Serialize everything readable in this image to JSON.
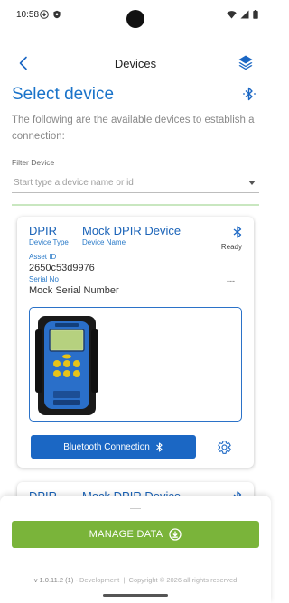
{
  "status_bar": {
    "time": "10:58"
  },
  "header": {
    "title": "Devices"
  },
  "page": {
    "title": "Select device",
    "intro": "The following are the available devices to establish a connection:"
  },
  "filter": {
    "label": "Filter Device",
    "placeholder": "Start type a device name or id"
  },
  "devices": [
    {
      "type": "DPIR",
      "type_caption": "Device Type",
      "name": "Mock DPIR Device",
      "name_caption": "Device Name",
      "status": "Ready",
      "asset_caption": "Asset ID",
      "asset_id": "2650c53d9976",
      "serial_caption": "Serial No",
      "serial": "Mock Serial Number",
      "extra": "---",
      "connect_label": "Bluetooth Connection"
    },
    {
      "type": "DPIR",
      "name": "Mock DPIR Device"
    }
  ],
  "bottom_sheet": {
    "manage_label": "MANAGE DATA",
    "version": "v 1.0.11.2 (1)",
    "env": "- Development",
    "copyright": "Copyright © 2026 all rights reserved"
  },
  "colors": {
    "primary": "#1b67c4",
    "title_blue": "#1a73c9",
    "manage_green": "#7ab43a"
  }
}
